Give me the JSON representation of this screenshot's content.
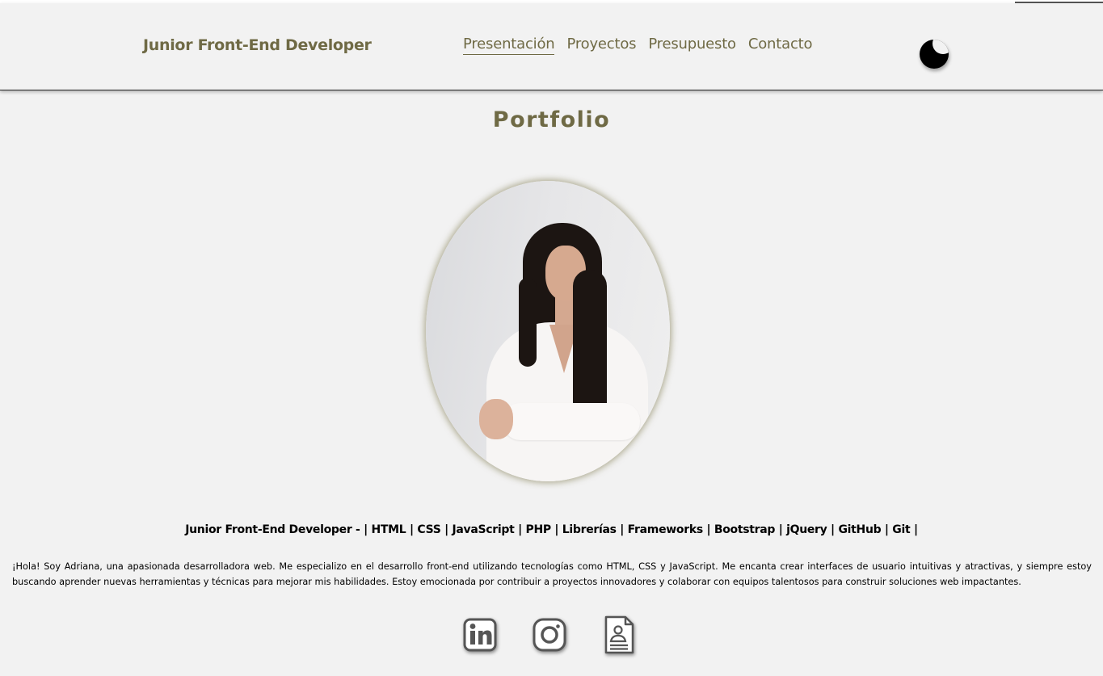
{
  "header": {
    "brand": "Junior Front-End Developer",
    "nav": [
      {
        "label": "Presentación",
        "active": true
      },
      {
        "label": "Proyectos",
        "active": false
      },
      {
        "label": "Presupuesto",
        "active": false
      },
      {
        "label": "Contacto",
        "active": false
      }
    ],
    "theme_toggle_icon": "moon-icon"
  },
  "main": {
    "title": "Portfolio",
    "portrait_icon": "profile-photo",
    "skills_line": "Junior Front-End Developer - | HTML | CSS | JavaScript | PHP | Librerías | Frameworks | Bootstrap | jQuery | GitHub | Git |",
    "bio": "¡Hola! Soy Adriana, una apasionada desarrolladora web. Me especializo en el desarrollo front-end utilizando tecnologías como HTML, CSS y JavaScript. Me encanta crear interfaces de usuario intuitivas y atractivas, y siempre estoy buscando aprender nuevas herramientas y técnicas para mejorar mis habilidades. Estoy emocionada por contribuir a proyectos innovadores y colaborar con equipos talentosos para construir soluciones web impactantes."
  },
  "socials": [
    {
      "icon": "linkedin-icon"
    },
    {
      "icon": "instagram-icon"
    },
    {
      "icon": "resume-document-icon"
    }
  ],
  "colors": {
    "accent": "#6f6a45",
    "background": "#f2f2f2"
  }
}
